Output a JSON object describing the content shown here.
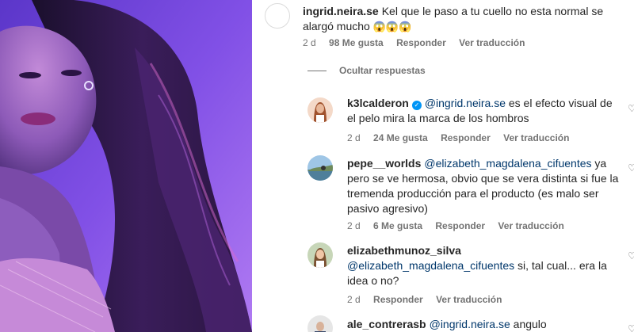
{
  "post": {
    "image_alt": "woman with long dark hair under purple light"
  },
  "comments": [
    {
      "username": "ingrid.neira.se",
      "text": "Kel que le paso a tu cuello no esta normal se alargó mucho",
      "emojis": "😱😱😱",
      "time": "2 d",
      "likes": "98 Me gusta",
      "reply": "Responder",
      "translate": "Ver traducción"
    }
  ],
  "hide_replies_label": "Ocultar respuestas",
  "replies": [
    {
      "username": "k3lcalderon",
      "mention": "@ingrid.neira.se",
      "text": " es el efecto visual de el pelo mira la marca de los hombros",
      "time": "2 d",
      "likes": "24 Me gusta",
      "reply": "Responder",
      "translate": "Ver traducción"
    },
    {
      "username": "pepe__worlds",
      "mention": "@elizabeth_magdalena_cifuentes",
      "text": " ya pero se ve hermosa, obvio que se vera distinta si fue la tremenda producción para el producto (es malo ser pasivo agresivo)",
      "time": "2 d",
      "likes": "6 Me gusta",
      "reply": "Responder",
      "translate": "Ver traducción"
    },
    {
      "username": "elizabethmunoz_silva",
      "mention": "@elizabeth_magdalena_cifuentes",
      "text": " si, tal cual... era la idea o no?",
      "time": "2 d",
      "reply": "Responder",
      "translate": "Ver traducción"
    },
    {
      "username": "ale_contrerasb",
      "mention": "@ingrid.neira.se",
      "text": " angulo"
    }
  ],
  "colors": {
    "mention": "#00376b",
    "verified": "#0095f6",
    "meta": "#737373"
  }
}
